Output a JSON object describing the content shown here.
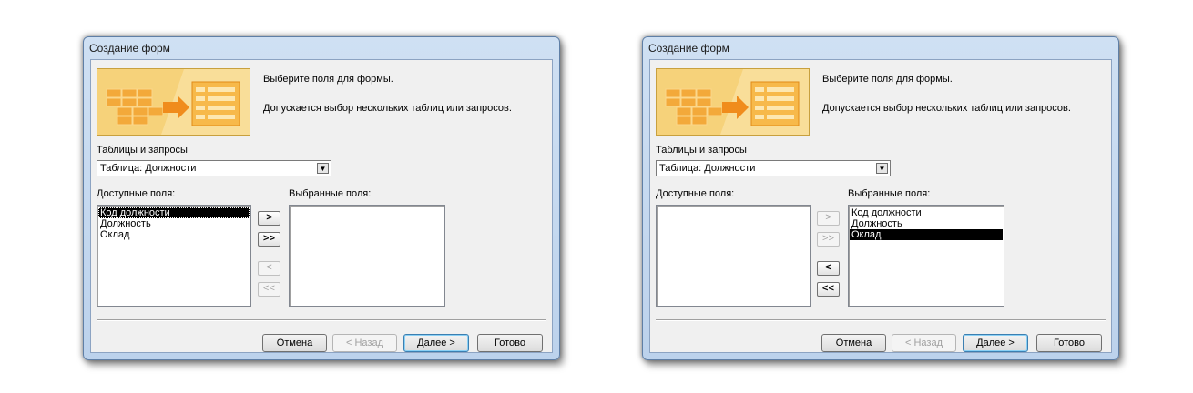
{
  "dialogs": [
    {
      "title": "Создание форм",
      "intro_line1": "Выберите поля для формы.",
      "intro_line2": "Допускается выбор нескольких таблиц или запросов.",
      "tables_label": "Таблицы и запросы",
      "table_value": "Таблица: Должности",
      "available_label": "Доступные поля:",
      "selected_label": "Выбранные поля:",
      "available_fields": [
        "Код должности",
        "Должность",
        "Оклад"
      ],
      "selected_fields": [],
      "buttons": {
        "add": ">",
        "add_all": ">>",
        "remove": "<",
        "remove_all": "<<"
      },
      "cancel": "Отмена",
      "back": "< Назад",
      "next": "Далее >",
      "finish": "Готово"
    },
    {
      "title": "Создание форм",
      "intro_line1": "Выберите поля для формы.",
      "intro_line2": "Допускается выбор нескольких таблиц или запросов.",
      "tables_label": "Таблицы и запросы",
      "table_value": "Таблица: Должности",
      "available_label": "Доступные поля:",
      "selected_label": "Выбранные поля:",
      "available_fields": [],
      "selected_fields": [
        "Код должности",
        "Должность",
        "Оклад"
      ],
      "buttons": {
        "add": ">",
        "add_all": ">>",
        "remove": "<",
        "remove_all": "<<"
      },
      "cancel": "Отмена",
      "back": "< Назад",
      "next": "Далее >",
      "finish": "Готово"
    }
  ]
}
